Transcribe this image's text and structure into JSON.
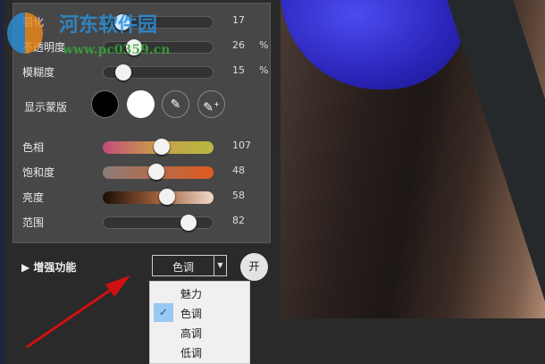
{
  "watermark": {
    "name": "河东软件园",
    "url": "www.pc0359.cn"
  },
  "sliders": [
    {
      "label": "羽化",
      "value": "17",
      "unit": "",
      "fraction": 0.17,
      "gradient": "#333"
    },
    {
      "label": "不透明度",
      "value": "26",
      "unit": "%",
      "fraction": 0.28,
      "gradient": "#333"
    },
    {
      "label": "模糊度",
      "value": "15",
      "unit": "%",
      "fraction": 0.18,
      "gradient": "#333"
    }
  ],
  "mask": {
    "label": "显示蒙版"
  },
  "color_sliders": [
    {
      "label": "色相",
      "value": "107",
      "fraction": 0.53
    },
    {
      "label": "饱和度",
      "value": "48",
      "fraction": 0.48
    },
    {
      "label": "亮度",
      "value": "58",
      "fraction": 0.58
    },
    {
      "label": "范围",
      "value": "82",
      "fraction": 0.78
    }
  ],
  "enhance": {
    "label": "增强功能",
    "selected": "色调",
    "toggle": "开"
  },
  "menu": [
    "魅力",
    "色调",
    "高调",
    "低调"
  ],
  "menu_checked": 1
}
